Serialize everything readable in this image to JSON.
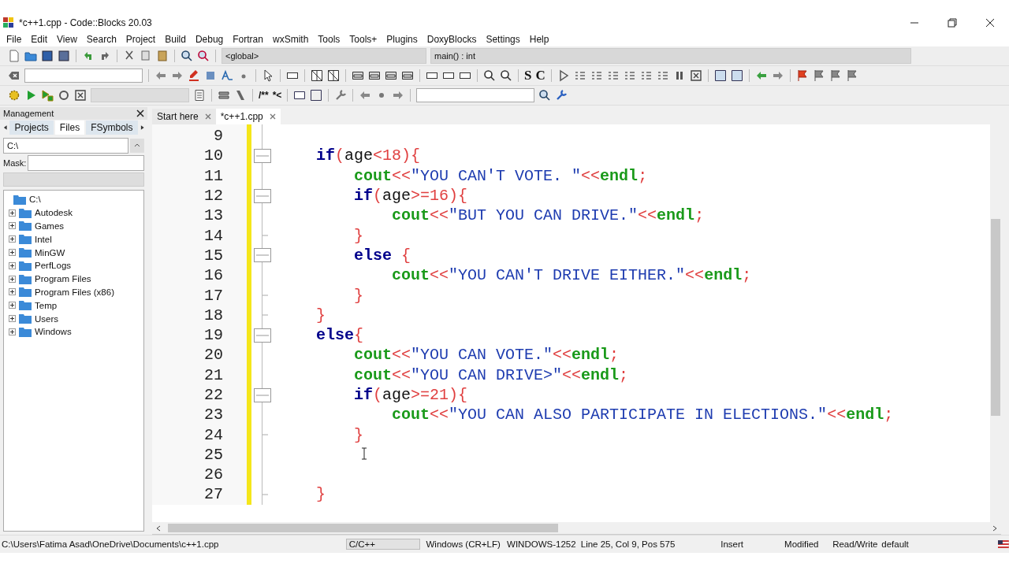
{
  "window": {
    "title": "*c++1.cpp - Code::Blocks 20.03"
  },
  "menu": [
    "File",
    "Edit",
    "View",
    "Search",
    "Project",
    "Build",
    "Debug",
    "Fortran",
    "wxSmith",
    "Tools",
    "Tools+",
    "Plugins",
    "DoxyBlocks",
    "Settings",
    "Help"
  ],
  "toolbar": {
    "scope": "<global>",
    "function": "main() : int",
    "style_buttons": [
      "S",
      "C"
    ],
    "doxy_buttons": [
      "/**",
      "*<"
    ]
  },
  "management": {
    "title": "Management",
    "tabs": [
      {
        "label": "Projects",
        "selected": false
      },
      {
        "label": "Files",
        "selected": true
      },
      {
        "label": "FSymbols",
        "selected": false
      }
    ],
    "path": "C:\\",
    "mask_label": "Mask:",
    "tree": {
      "label": "C:\\",
      "children": [
        {
          "label": "Autodesk",
          "expanded": false
        },
        {
          "label": "Games",
          "expanded": false
        },
        {
          "label": "Intel",
          "expanded": false
        },
        {
          "label": "MinGW",
          "expanded": false
        },
        {
          "label": "PerfLogs",
          "expanded": false
        },
        {
          "label": "Program Files",
          "expanded": false
        },
        {
          "label": "Program Files (x86)",
          "expanded": false
        },
        {
          "label": "Temp",
          "expanded": false
        },
        {
          "label": "Users",
          "expanded": false
        },
        {
          "label": "Windows",
          "expanded": false
        }
      ]
    }
  },
  "editor_tabs": [
    {
      "label": "Start here",
      "selected": false
    },
    {
      "label": "*c++1.cpp",
      "selected": true
    }
  ],
  "code": [
    {
      "number": "9",
      "kind": "plain"
    },
    {
      "number": "10",
      "kind": "fold_start",
      "tokens": [
        {
          "t": "    if",
          "kind": "keyword"
        },
        {
          "t": "(",
          "kind": "op"
        },
        {
          "t": "age",
          "kind": "plain"
        },
        {
          "t": "<",
          "kind": "op"
        },
        {
          "t": "18",
          "kind": "number"
        },
        {
          "t": "){",
          "kind": "op"
        }
      ]
    },
    {
      "number": "11",
      "kind": "plain",
      "tokens": [
        {
          "t": "        cout",
          "kind": "stream"
        },
        {
          "t": "<<",
          "kind": "op"
        },
        {
          "t": "\"YOU CAN'T VOTE. \"",
          "kind": "string"
        },
        {
          "t": "<<",
          "kind": "op"
        },
        {
          "t": "endl",
          "kind": "stream"
        },
        {
          "t": ";",
          "kind": "op"
        }
      ]
    },
    {
      "number": "12",
      "kind": "fold_start",
      "tokens": [
        {
          "t": "        if",
          "kind": "keyword"
        },
        {
          "t": "(",
          "kind": "op"
        },
        {
          "t": "age",
          "kind": "plain"
        },
        {
          "t": ">=",
          "kind": "op"
        },
        {
          "t": "16",
          "kind": "number"
        },
        {
          "t": "){",
          "kind": "op"
        }
      ]
    },
    {
      "number": "13",
      "kind": "plain",
      "tokens": [
        {
          "t": "            cout",
          "kind": "stream"
        },
        {
          "t": "<<",
          "kind": "op"
        },
        {
          "t": "\"BUT YOU CAN DRIVE.\"",
          "kind": "string"
        },
        {
          "t": "<<",
          "kind": "op"
        },
        {
          "t": "endl",
          "kind": "stream"
        },
        {
          "t": ";",
          "kind": "op"
        }
      ]
    },
    {
      "number": "14",
      "kind": "fold_end",
      "tokens": [
        {
          "t": "        }",
          "kind": "op"
        }
      ]
    },
    {
      "number": "15",
      "kind": "fold_start",
      "tokens": [
        {
          "t": "        else",
          "kind": "keyword"
        },
        {
          "t": " {",
          "kind": "op"
        }
      ]
    },
    {
      "number": "16",
      "kind": "plain",
      "tokens": [
        {
          "t": "            cout",
          "kind": "stream"
        },
        {
          "t": "<<",
          "kind": "op"
        },
        {
          "t": "\"YOU CAN'T DRIVE EITHER.\"",
          "kind": "string"
        },
        {
          "t": "<<",
          "kind": "op"
        },
        {
          "t": "endl",
          "kind": "stream"
        },
        {
          "t": ";",
          "kind": "op"
        }
      ]
    },
    {
      "number": "17",
      "kind": "fold_end",
      "tokens": [
        {
          "t": "        }",
          "kind": "op"
        }
      ]
    },
    {
      "number": "18",
      "kind": "fold_end",
      "tokens": [
        {
          "t": "    }",
          "kind": "op"
        }
      ]
    },
    {
      "number": "19",
      "kind": "fold_start",
      "tokens": [
        {
          "t": "    else",
          "kind": "keyword"
        },
        {
          "t": "{",
          "kind": "op"
        }
      ]
    },
    {
      "number": "20",
      "kind": "plain",
      "tokens": [
        {
          "t": "        cout",
          "kind": "stream"
        },
        {
          "t": "<<",
          "kind": "op"
        },
        {
          "t": "\"YOU CAN VOTE.\"",
          "kind": "string"
        },
        {
          "t": "<<",
          "kind": "op"
        },
        {
          "t": "endl",
          "kind": "stream"
        },
        {
          "t": ";",
          "kind": "op"
        }
      ]
    },
    {
      "number": "21",
      "kind": "plain",
      "tokens": [
        {
          "t": "        cout",
          "kind": "stream"
        },
        {
          "t": "<<",
          "kind": "op"
        },
        {
          "t": "\"YOU CAN DRIVE>\"",
          "kind": "string"
        },
        {
          "t": "<<",
          "kind": "op"
        },
        {
          "t": "endl",
          "kind": "stream"
        },
        {
          "t": ";",
          "kind": "op"
        }
      ]
    },
    {
      "number": "22",
      "kind": "fold_start",
      "tokens": [
        {
          "t": "        if",
          "kind": "keyword"
        },
        {
          "t": "(",
          "kind": "op"
        },
        {
          "t": "age",
          "kind": "plain"
        },
        {
          "t": ">=",
          "kind": "op"
        },
        {
          "t": "21",
          "kind": "number"
        },
        {
          "t": "){",
          "kind": "op"
        }
      ]
    },
    {
      "number": "23",
      "kind": "plain",
      "tokens": [
        {
          "t": "            cout",
          "kind": "stream"
        },
        {
          "t": "<<",
          "kind": "op"
        },
        {
          "t": "\"YOU CAN ALSO PARTICIPATE IN ELECTIONS.\"",
          "kind": "string"
        },
        {
          "t": "<<",
          "kind": "op"
        },
        {
          "t": "endl",
          "kind": "stream"
        },
        {
          "t": ";",
          "kind": "op"
        }
      ]
    },
    {
      "number": "24",
      "kind": "fold_end",
      "tokens": [
        {
          "t": "        }",
          "kind": "op"
        }
      ]
    },
    {
      "number": "25",
      "kind": "plain"
    },
    {
      "number": "26",
      "kind": "plain"
    },
    {
      "number": "27",
      "kind": "fold_end",
      "tokens": [
        {
          "t": "    }",
          "kind": "op"
        }
      ]
    }
  ],
  "status_bar": {
    "path": "C:\\Users\\Fatima Asad\\OneDrive\\Documents\\c++1.cpp",
    "language": "C/C++",
    "line_endings": "Windows (CR+LF)",
    "encoding": "WINDOWS-1252",
    "position": "Line 25, Col 9, Pos 575",
    "mode": "Insert",
    "modified": "Modified",
    "access": "Read/Write",
    "profile": "default"
  }
}
